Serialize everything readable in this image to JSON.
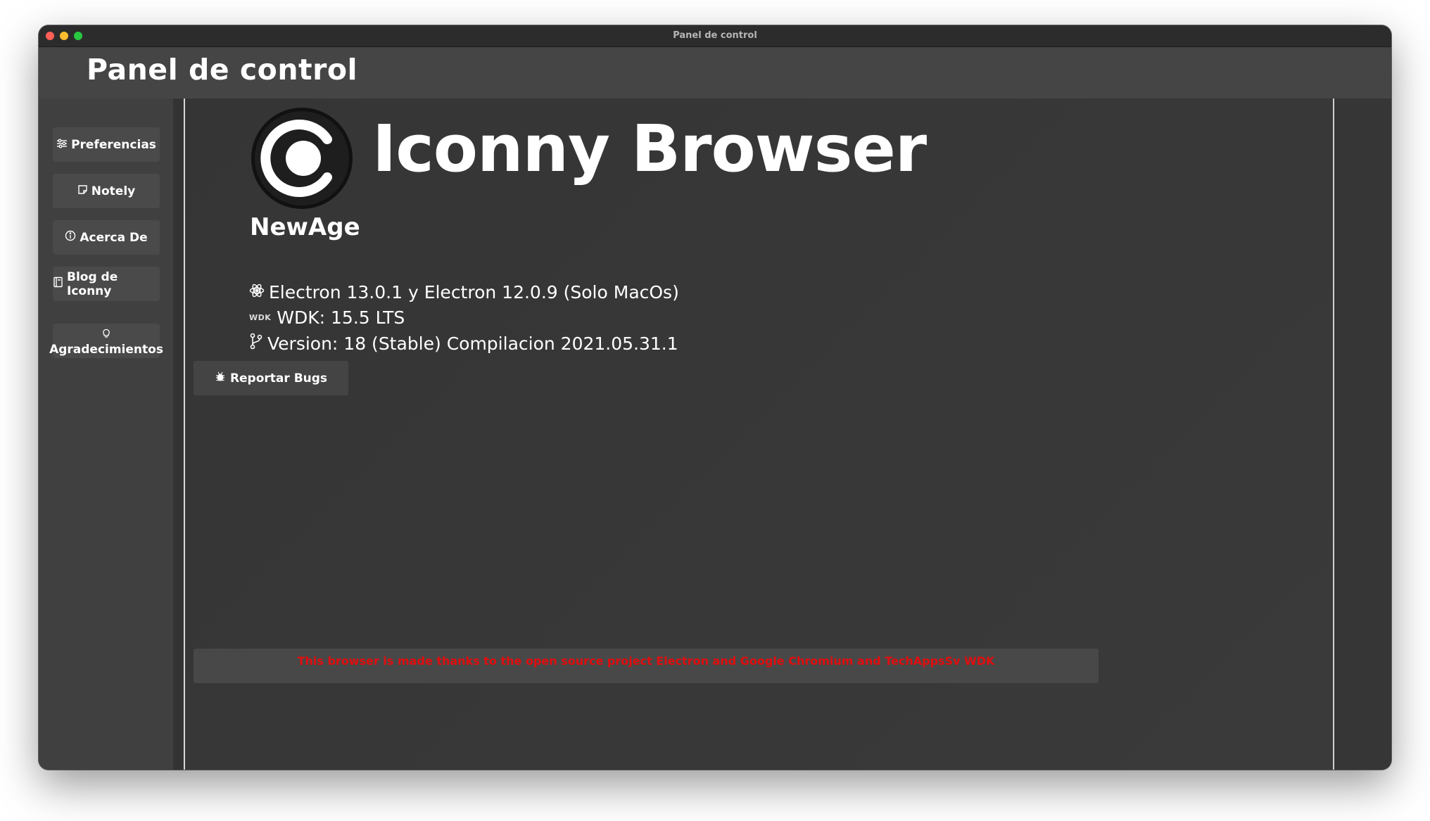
{
  "window": {
    "title": "Panel de control"
  },
  "header": {
    "title": "Panel de control"
  },
  "sidebar": {
    "items": [
      {
        "label": "Preferencias",
        "icon": "sliders-icon"
      },
      {
        "label": "Notely",
        "icon": "note-icon"
      },
      {
        "label": "Acerca De",
        "icon": "info-icon"
      },
      {
        "label": "Blog de Iconny",
        "icon": "book-icon"
      },
      {
        "label": "Agradecimientos",
        "icon": "lightbulb-icon"
      }
    ]
  },
  "about": {
    "app_name": "Iconny Browser",
    "edition": "NewAge",
    "electron": "Electron 13.0.1 y Electron 12.0.9 (Solo MacOs)",
    "wdk_mark": "WDK",
    "wdk": "WDK: 15.5 LTS",
    "version": "Version: 18 (Stable) Compilacion 2021.05.31.1",
    "report_label": "Reportar Bugs"
  },
  "footer": {
    "credits": "This browser is made thanks to the open source project Electron and Google Chromium and TechAppsSv WDK"
  },
  "colors": {
    "window_bg": "#3c3c3c",
    "header_bg": "#454545",
    "credits_text": "#e10e0e"
  }
}
